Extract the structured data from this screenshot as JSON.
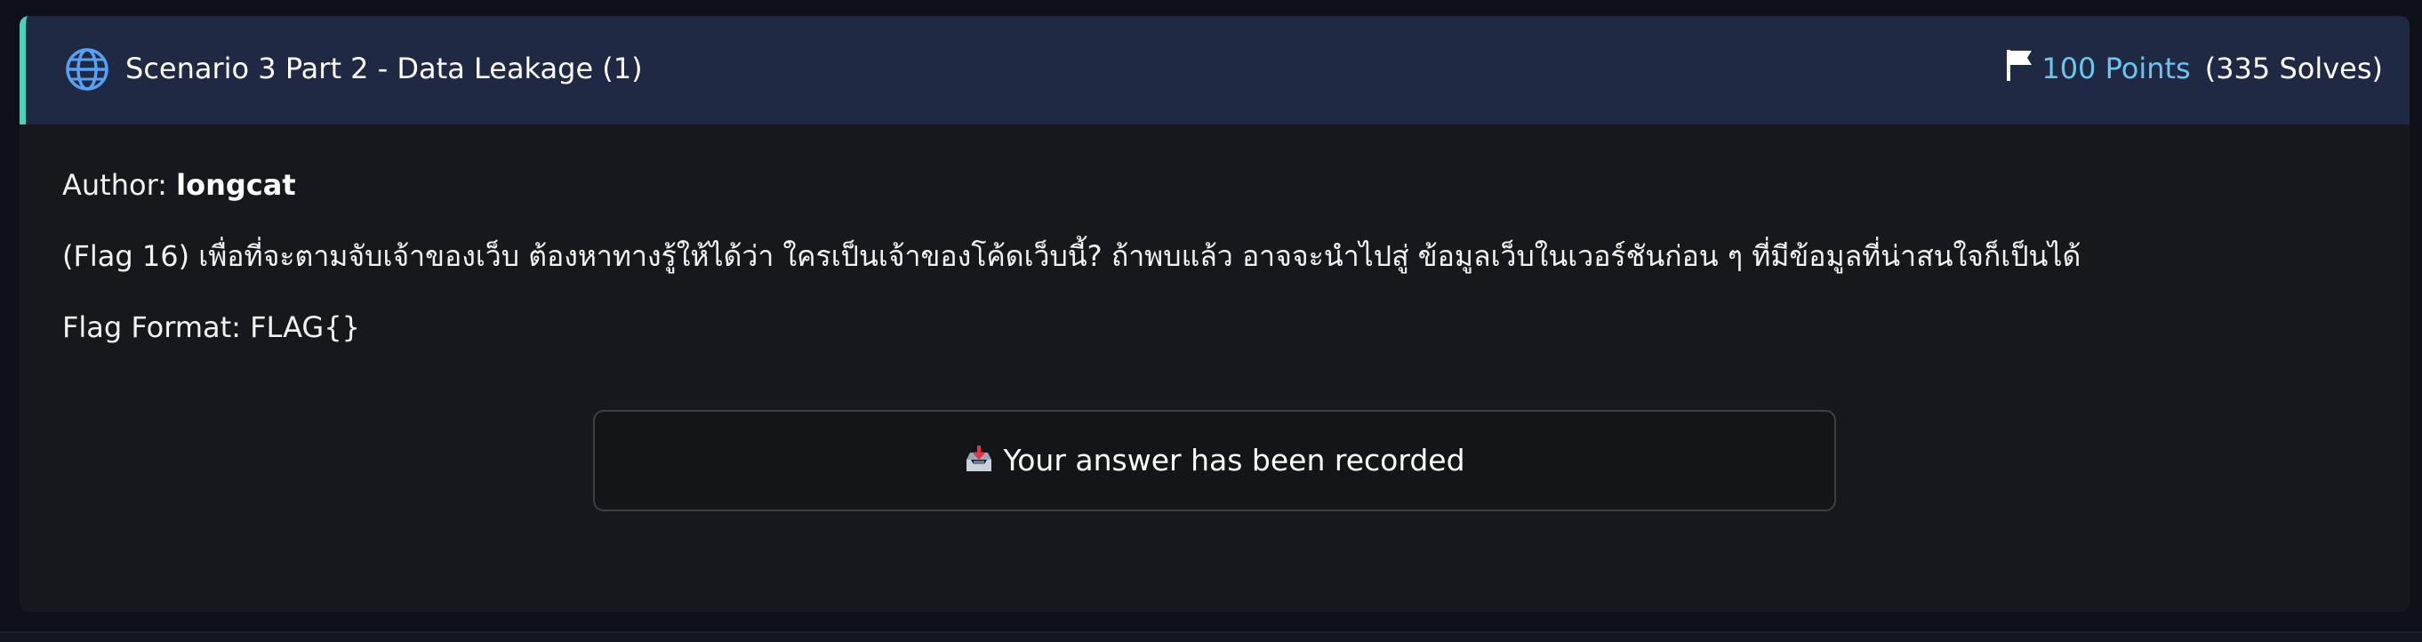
{
  "challenge": {
    "title": "Scenario 3 Part 2 - Data Leakage (1)",
    "category_icon": "globe-icon",
    "points": "100 Points",
    "solves": "(335 Solves)",
    "points_icon": "flag-icon"
  },
  "body": {
    "author_label": "Author:",
    "author_name": "longcat",
    "description": "(Flag 16) เพื่อที่จะตามจับเจ้าของเว็บ ต้องหาทางรู้ให้ได้ว่า ใครเป็นเจ้าของโค้ดเว็บนี้? ถ้าพบแล้ว อาจจะนำไปสู่ ข้อมูลเว็บในเวอร์ชันก่อน ๆ ที่มีข้อมูลที่น่าสนใจก็เป็นได้",
    "flag_format": "Flag Format: FLAG{}"
  },
  "answer_status": {
    "icon": "inbox-tray-icon",
    "text": "Your answer has been recorded"
  },
  "colors": {
    "header_bg": "#1f2943",
    "accent_border": "#4fd1b8",
    "points": "#6cc4f0",
    "card_bg": "#17181d",
    "page_bg": "#0e1118"
  }
}
